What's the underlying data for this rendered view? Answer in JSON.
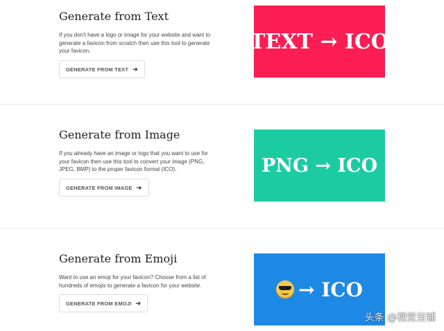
{
  "sections": [
    {
      "title": "Generate from Text",
      "description": "If you don't have a logo or image for your website and want to generate a favicon from scratch then use this tool to generate your favicon.",
      "button_label": "GENERATE FROM TEXT",
      "banner_label": "TEXT → ICO",
      "banner_color": "#fb1d53"
    },
    {
      "title": "Generate from Image",
      "description": "If you already have an image or logo that you want to use for your favicon then use this tool to convert your image (PNG, JPEG, BMP) to the proper favicon format (ICO).",
      "button_label": "GENERATE FROM IMAGE",
      "banner_label": "PNG → ICO",
      "banner_color": "#1dcba3"
    },
    {
      "title": "Generate from Emoji",
      "description": "Want to use an emoji for your favicon? Choose from a list of hundreds of emojis to generate a favicon for your website.",
      "button_label": "GENERATE FROM EMOJI",
      "banner_label": "→ ICO",
      "banner_color": "#1e88e5",
      "banner_icon": "sunglasses-emoji-icon"
    }
  ],
  "watermark": "头条 @视觉当铺"
}
